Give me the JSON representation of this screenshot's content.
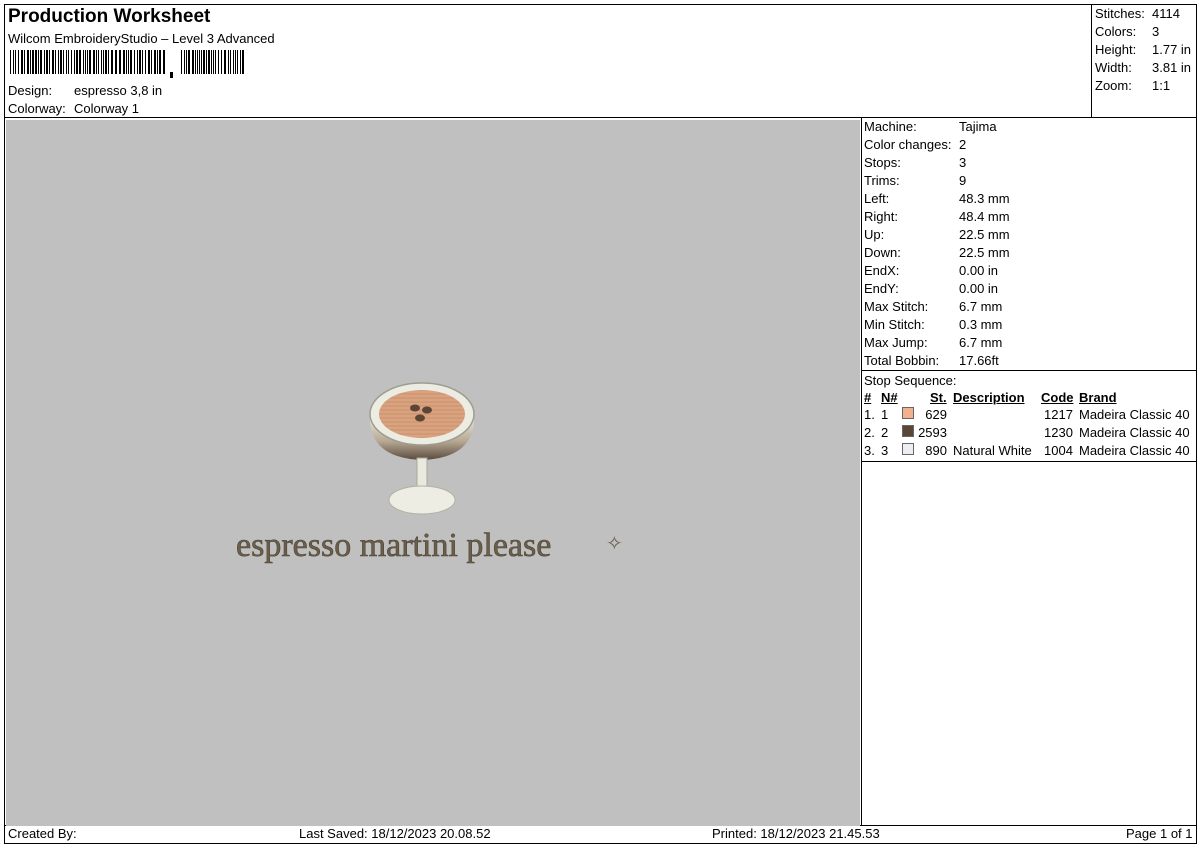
{
  "header": {
    "title": "Production Worksheet",
    "subtitle": "Wilcom EmbroideryStudio – Level 3 Advanced",
    "barcode_icon": "barcode-icon",
    "design_label": "Design:",
    "design_value": "espresso 3,8 in",
    "colorway_label": "Colorway:",
    "colorway_value": "Colorway 1"
  },
  "summary": [
    {
      "label": "Stitches:",
      "value": "4114"
    },
    {
      "label": "Colors:",
      "value": "3"
    },
    {
      "label": "Height:",
      "value": "1.77 in"
    },
    {
      "label": "Width:",
      "value": "3.81 in"
    },
    {
      "label": "Zoom:",
      "value": "1:1"
    }
  ],
  "design": {
    "text": "espresso martini please",
    "sparkle": "✧",
    "colors": {
      "background": "#c0c0c0",
      "coffee": "#d9a37f",
      "rim": "#ecece3",
      "glass_shadow": "#5a4b3d",
      "text": "#6b5f4b"
    }
  },
  "machine": [
    {
      "label": "Machine:",
      "value": "Tajima"
    },
    {
      "label": "Color changes:",
      "value": "2"
    },
    {
      "label": "Stops:",
      "value": "3"
    },
    {
      "label": "Trims:",
      "value": "9"
    },
    {
      "label": "Left:",
      "value": "48.3 mm"
    },
    {
      "label": "Right:",
      "value": "48.4 mm"
    },
    {
      "label": "Up:",
      "value": "22.5 mm"
    },
    {
      "label": "Down:",
      "value": "22.5 mm"
    },
    {
      "label": "EndX:",
      "value": "0.00 in"
    },
    {
      "label": "EndY:",
      "value": "0.00 in"
    },
    {
      "label": "Max Stitch:",
      "value": "6.7 mm"
    },
    {
      "label": "Min Stitch:",
      "value": "0.3 mm"
    },
    {
      "label": "Max Jump:",
      "value": "6.7 mm"
    },
    {
      "label": "Total Bobbin:",
      "value": "17.66ft"
    }
  ],
  "stop_sequence": {
    "title": "Stop Sequence:",
    "headers": {
      "num": "#",
      "n": "N#",
      "st": "St.",
      "description": "Description",
      "code": "Code",
      "brand": "Brand"
    },
    "rows": [
      {
        "num": "1.",
        "n": "1",
        "color": "#f2b08e",
        "st": "629",
        "description": "",
        "code": "1217",
        "brand": "Madeira Classic 40"
      },
      {
        "num": "2.",
        "n": "2",
        "color": "#5b4636",
        "st": "2593",
        "description": "",
        "code": "1230",
        "brand": "Madeira Classic 40"
      },
      {
        "num": "3.",
        "n": "3",
        "color": "#eeeef2",
        "st": "890",
        "description": "Natural White",
        "code": "1004",
        "brand": "Madeira Classic 40"
      }
    ]
  },
  "footer": {
    "created_by": "Created By:",
    "last_saved": "Last Saved: 18/12/2023 20.08.52",
    "printed": "Printed: 18/12/2023 21.45.53",
    "page": "Page 1 of 1"
  }
}
